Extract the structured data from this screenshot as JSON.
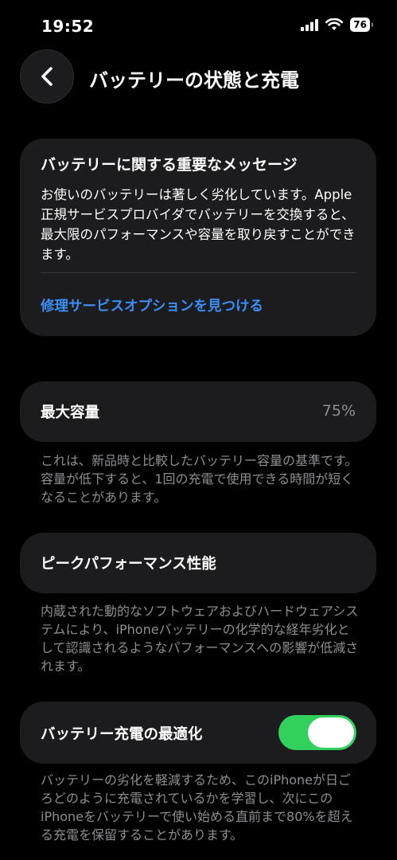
{
  "status_bar": {
    "time": "19:52",
    "battery_level": "76",
    "icons": [
      "cellular-signal-icon",
      "wifi-icon",
      "battery-icon"
    ]
  },
  "header": {
    "title": "バッテリーの状態と充電",
    "back_icon": "chevron-left-icon"
  },
  "alert": {
    "title": "バッテリーに関する重要なメッセージ",
    "body": "お使いのバッテリーは著しく劣化しています。Apple 正規サービスプロバイダでバッテリーを交換すると、最大限のパフォーマンスや容量を取り戻すことができます。",
    "link": "修理サービスオプションを見つける",
    "link_color": "#3a8ef6"
  },
  "max_capacity": {
    "label": "最大容量",
    "value": "75%",
    "footnote": "これは、新品時と比較したバッテリー容量の基準です。容量が低下すると、1回の充電で使用できる時間が短くなることがあります。"
  },
  "peak_performance": {
    "label": "ピークパフォーマンス性能",
    "footnote": "内蔵された動的なソフトウェアおよびハードウェアシステムにより、iPhoneバッテリーの化学的な経年劣化として認識されるようなパフォーマンスへの影響が低減されます。"
  },
  "optimized_charging": {
    "label": "バッテリー充電の最適化",
    "enabled": true,
    "toggle_color": "#32d15d",
    "footnote": "バッテリーの劣化を軽減するため、このiPhoneが日ごろどのように充電されているかを学習し、次にこのiPhoneをバッテリーで使い始める直前まで80%を超える充電を保留することがあります。"
  }
}
